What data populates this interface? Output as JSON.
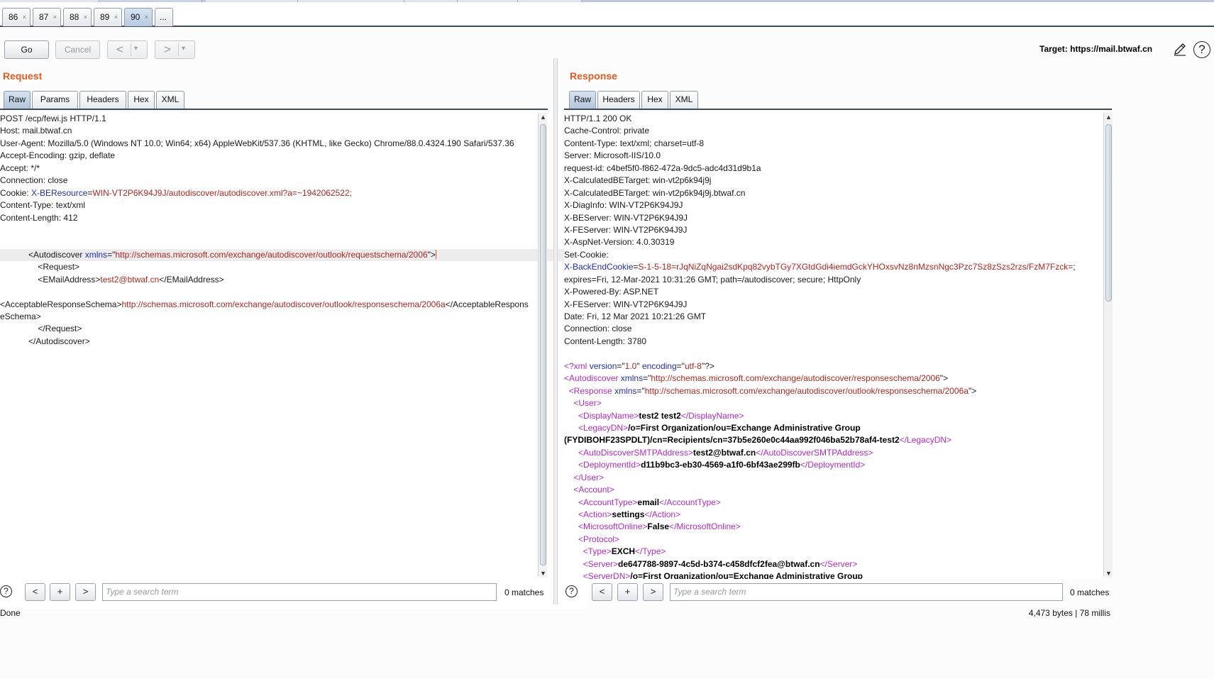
{
  "tabs": [
    {
      "label": "86",
      "close": "×"
    },
    {
      "label": "87",
      "close": "×"
    },
    {
      "label": "88",
      "close": "×"
    },
    {
      "label": "89",
      "close": "×"
    },
    {
      "label": "90",
      "close": "×",
      "active": true
    },
    {
      "label": "...",
      "close": ""
    }
  ],
  "toolbar": {
    "go": "Go",
    "cancel": "Cancel",
    "back": "<",
    "forward": ">",
    "dropdown": "▾",
    "target_label": "Target: https://mail.btwaf.cn",
    "help": "?"
  },
  "request": {
    "title": "Request",
    "tabs": [
      "Raw",
      "Params",
      "Headers",
      "Hex",
      "XML"
    ],
    "search_placeholder": "Type a search term",
    "matches": "0 matches"
  },
  "response": {
    "title": "Response",
    "tabs": [
      "Raw",
      "Headers",
      "Hex",
      "XML"
    ],
    "search_placeholder": "Type a search term",
    "matches": "0 matches"
  },
  "search_buttons": {
    "prev": "<",
    "add": "+",
    "next": ">"
  },
  "status": {
    "left": "Done",
    "right": "4,473 bytes | 78 millis"
  },
  "colors": {
    "accent": "#e8591c",
    "tab_active": "#b7cbe2",
    "header_key": "#1f2db3",
    "header_value": "#b1261e",
    "xml_tag": "#b12ac4"
  }
}
